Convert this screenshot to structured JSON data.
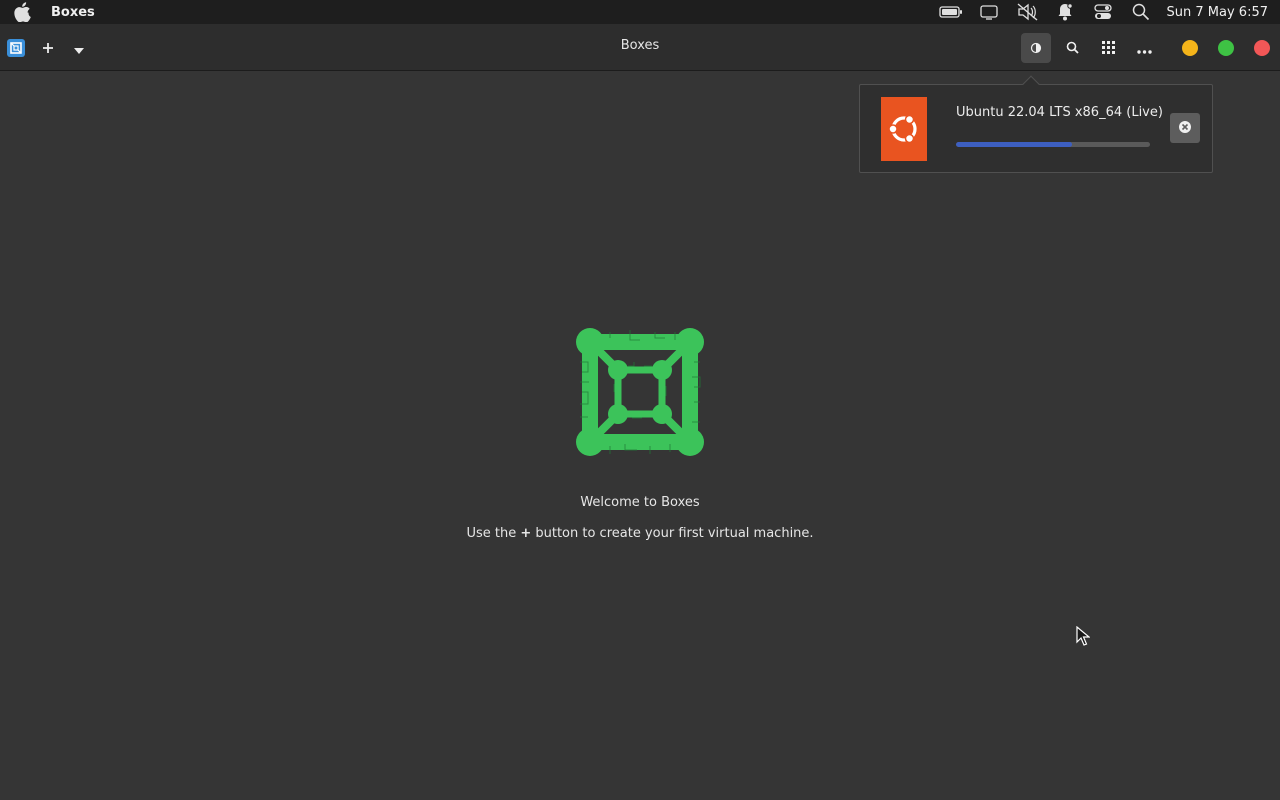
{
  "system_bar": {
    "app_name": "Boxes",
    "clock": "Sun 7 May 6:57",
    "icons": [
      "apple-icon",
      "battery-icon",
      "display-icon",
      "volume-muted-icon",
      "notifications-icon",
      "control-center-icon",
      "spotlight-search-icon"
    ]
  },
  "header": {
    "title": "Boxes",
    "add_label": "+",
    "buttons": [
      "theme-toggle-icon",
      "search-icon",
      "grid-view-icon",
      "more-icon"
    ],
    "window_controls": {
      "minimize_color": "#f4b41a",
      "maximize_color": "#3ec244",
      "close_color": "#f25757"
    }
  },
  "downloads": {
    "item_name": "Ubuntu 22.04 LTS x86_64 (Live)",
    "progress": 0.6,
    "logo_color": "#e95420",
    "accent": "#3d5fc1"
  },
  "empty_state": {
    "welcome": "Welcome to Boxes",
    "hint_before": "Use the ",
    "hint_plus": "+",
    "hint_after": " button to create your first virtual machine.",
    "logo_color": "#3cc35a"
  }
}
